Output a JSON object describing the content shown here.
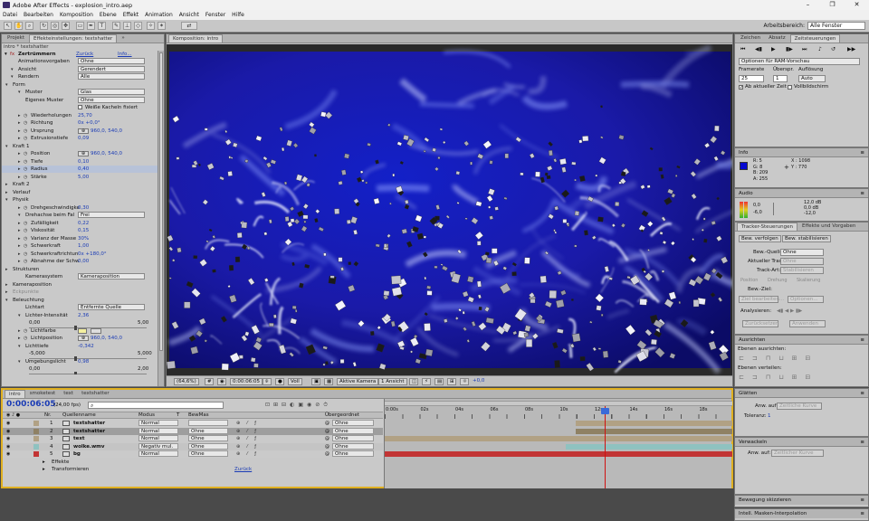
{
  "window": {
    "title": "Adobe After Effects - explosion_intro.aep",
    "min": "–",
    "max": "❐",
    "close": "✕"
  },
  "menu": [
    "Datei",
    "Bearbeiten",
    "Komposition",
    "Ebene",
    "Effekt",
    "Animation",
    "Ansicht",
    "Fenster",
    "Hilfe"
  ],
  "workspace": {
    "label": "Arbeitsbereich:",
    "value": "Alle Fenster"
  },
  "left": {
    "tabs": [
      "Projekt",
      "Effekteinstellungen: textshatter",
      "»"
    ],
    "crumb": "intro * textshatter",
    "effect": {
      "name": "Zertrümmern",
      "reset": "Zurück",
      "info": "Info..."
    },
    "rows": [
      {
        "l": "Animationsvorgaben",
        "s": "Ohne",
        "ind": 18
      },
      {
        "l": "Ansicht",
        "s": "Gerendert",
        "ind": 18,
        "tw": 1
      },
      {
        "l": "Rendern",
        "s": "Alle",
        "ind": 18,
        "tw": 1
      },
      {
        "l": "Form",
        "ind": 12,
        "tw": 1
      },
      {
        "l": "Muster",
        "s": "Glas",
        "ind": 26,
        "tw": 1
      },
      {
        "l": "Eigenes Muster",
        "s": "Ohne",
        "ind": 26
      },
      {
        "l": "",
        "v": "Weiße Kacheln fixiert",
        "cb": 1,
        "ind": 26
      },
      {
        "l": "Wiederholungen",
        "v": "25,70",
        "ind": 26,
        "tw": 2
      },
      {
        "l": "Richtung",
        "v": "0x +0,0°",
        "ind": 26,
        "tw": 2
      },
      {
        "l": "Ursprung",
        "v": "960,0, 540,0",
        "ind": 26,
        "tw": 2
      },
      {
        "l": "Extrusionstiefe",
        "v": "0,09",
        "ind": 26,
        "tw": 2
      },
      {
        "l": "Kraft 1",
        "ind": 12,
        "tw": 1
      },
      {
        "l": "Position",
        "v": "960,0, 540,0",
        "ind": 26,
        "tw": 2
      },
      {
        "l": "Tiefe",
        "v": "0,10",
        "ind": 26,
        "tw": 2
      },
      {
        "l": "Radius",
        "v": "0,40",
        "ind": 26,
        "tw": 2,
        "hl": 1
      },
      {
        "l": "Stärke",
        "v": "5,00",
        "ind": 26,
        "tw": 2
      },
      {
        "l": "Kraft 2",
        "ind": 12,
        "tw": 2
      },
      {
        "l": "Verlauf",
        "ind": 12,
        "tw": 2
      },
      {
        "l": "Physik",
        "ind": 12,
        "tw": 1
      },
      {
        "l": "Drehgeschwindigke",
        "v": "0,30",
        "ind": 26,
        "tw": 2
      },
      {
        "l": "Drehachse beim Fal",
        "s": "Frei",
        "ind": 26,
        "tw": 1
      },
      {
        "l": "Zufälligkeit",
        "v": "0,22",
        "ind": 26,
        "tw": 2
      },
      {
        "l": "Viskosität",
        "v": "0,15",
        "ind": 26,
        "tw": 2
      },
      {
        "l": "Varianz der Masse",
        "v": "30%",
        "ind": 26,
        "tw": 2
      },
      {
        "l": "Schwerkraft",
        "v": "1,00",
        "ind": 26,
        "tw": 2
      },
      {
        "l": "Schwerkraftrichtun",
        "v": "0x +180,0°",
        "ind": 26,
        "tw": 2
      },
      {
        "l": "Abnahme der Schw",
        "v": "0,00",
        "ind": 26,
        "tw": 2
      },
      {
        "l": "Strukturen",
        "ind": 12,
        "tw": 2
      },
      {
        "l": "Kamerasystem",
        "s": "Kameraposition",
        "ind": 26
      },
      {
        "l": "Kameraposition",
        "ind": 12,
        "tw": 2
      },
      {
        "l": "Eckpunkte",
        "ind": 12,
        "tw": 2,
        "dim": 1
      },
      {
        "l": "Beleuchtung",
        "ind": 12,
        "tw": 1
      },
      {
        "l": "Lichtart",
        "s": "Entfernte Quelle",
        "ind": 26
      },
      {
        "l": "Lichter-Intensität",
        "v": "2,36",
        "ind": 26,
        "tw": 1
      },
      {
        "l": "0,00",
        "v": "5,00",
        "ind": 30,
        "slider": 1
      },
      {
        "l": "Lichtfarbe",
        "ind": 26,
        "tw": 2,
        "swatch": 1
      },
      {
        "l": "Lichtposition",
        "v": "960,0, 540,0",
        "ind": 26,
        "tw": 2
      },
      {
        "l": "Lichttiefe",
        "v": "-0,342",
        "ind": 26,
        "tw": 1
      },
      {
        "l": "-5,000",
        "v": "5,000",
        "ind": 30,
        "slider": 1
      },
      {
        "l": "Umgebungslicht",
        "v": "0,98",
        "ind": 26,
        "tw": 1
      },
      {
        "l": "0,00",
        "v": "2,00",
        "ind": 30,
        "slider": 1
      }
    ]
  },
  "comp": {
    "tab": "Komposition: intro",
    "zoom": "(64,6%)",
    "time": "0:00:06:05",
    "res": "Voll",
    "camera": "Aktive Kamera",
    "views": "1 Ansicht",
    "exposure": "+0,0"
  },
  "right": {
    "tabs": [
      "Zeichen",
      "Absatz",
      "Zeitsteuerungen"
    ],
    "ram": "Optionen für RAM-Vorschau",
    "framerate_lbl": "Framerate",
    "skip_lbl": "Überspr.",
    "res_lbl": "Auflösung",
    "framerate": "25",
    "skip": "1",
    "res": "Auto",
    "from_current": "Ab aktueller Zeit",
    "fullscreen": "Vollbildschirm",
    "info": {
      "title": "Info",
      "r": "R:  5",
      "g": "G:  8",
      "b": "B:  209",
      "a": "A:  255",
      "x": "X : 1098",
      "y": "Y : 770"
    },
    "audio": {
      "title": "Audio",
      "db1": "0,0",
      "db2": "-6,0",
      "db3": "12,0 dB",
      "db4": "0,0 dB",
      "db5": "-12,0"
    },
    "tracker": {
      "tabs": [
        "Tracker-Steuerungen",
        "Effekte und Vorgaben"
      ],
      "btn1": "Bew. verfolgen",
      "btn2": "Bew. stabilisieren",
      "src_lbl": "Bew.-Quelle:",
      "src": "Ohne",
      "track_lbl": "Aktueller Track:",
      "track": "Ohne",
      "type_lbl": "Track-Art:",
      "type": "Stabilisieren",
      "pos": "Position",
      "rot": "Drehung",
      "scale": "Skalierung",
      "target": "Bew.-Ziel:",
      "edit": "Ziel bearbeiten...",
      "opts": "Optionen...",
      "analyze": "Analysieren:",
      "reset": "Zurücksetzen",
      "apply": "Anwenden"
    },
    "align": {
      "title": "Ausrichten",
      "lbl1": "Ebenen ausrichten:",
      "lbl2": "Ebenen verteilen:"
    },
    "smooth": {
      "title": "Glätten",
      "apply_lbl": "Anw. auf:",
      "apply": "Zeitliche Kurve",
      "tol_lbl": "Toleranz:",
      "tol": "1"
    },
    "wiggle": {
      "title": "Verwackeln",
      "apply_lbl": "Anw. auf:",
      "apply": "Zeitlicher Kurve"
    },
    "motion": "Bewegung skizzieren",
    "mask": "Intell. Masken-Interpolation"
  },
  "timeline": {
    "tabs": [
      "intro",
      "smoketest",
      "text",
      "textshatter"
    ],
    "time": "0:00:06:05",
    "fps": "(24,00 fps)",
    "cols": [
      "Nr.",
      "Quellenname",
      "Modus",
      "T",
      "BewMas",
      "Übergeordnet"
    ],
    "ruler": [
      "0:00s",
      "02s",
      "04s",
      "06s",
      "08s",
      "10s",
      "12s",
      "14s",
      "16s",
      "18s"
    ],
    "layers": [
      {
        "n": "1",
        "name": "textshatter",
        "mode": "Normal",
        "mat": "",
        "parent": "Ohne",
        "color": "#b1a184"
      },
      {
        "n": "2",
        "name": "textshatter",
        "mode": "Normal",
        "mat": "Ohne",
        "parent": "Ohne",
        "color": "#8f8164"
      },
      {
        "n": "3",
        "name": "text",
        "mode": "Normal",
        "mat": "Ohne",
        "parent": "Ohne",
        "color": "#b1a184"
      },
      {
        "n": "4",
        "name": "wolke.wmv",
        "mode": "Negativ mul.",
        "mat": "Ohne",
        "parent": "Ohne",
        "color": "#8fc2c0"
      },
      {
        "n": "5",
        "name": "bg",
        "mode": "Normal",
        "mat": "Ohne",
        "parent": "Ohne",
        "color": "#c23434"
      }
    ],
    "effects": "Effekte",
    "transform": "Transformieren",
    "reset": "Zurück"
  }
}
